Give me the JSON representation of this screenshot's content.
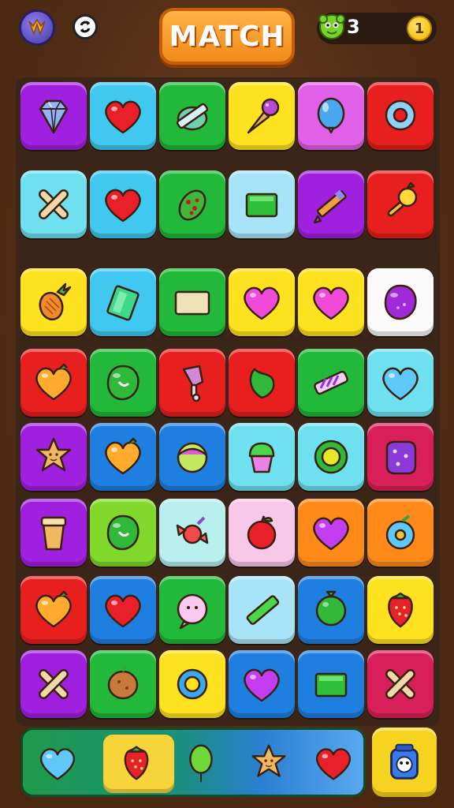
{
  "header": {
    "title": "MATCH",
    "moves": "3",
    "coins": "1"
  },
  "colors": {
    "purple": "#a020e0",
    "cyan": "#40c8f0",
    "green": "#22b83a",
    "yellow": "#ffe21f",
    "pink": "#e060e8",
    "red": "#e81f1f",
    "lightcyan": "#6fe0f0",
    "blue": "#1f7fe0",
    "lime": "#7fd82a",
    "white": "#fafafa",
    "orange": "#ff8a1a",
    "crimson": "#d81f5a",
    "paleblue": "#a8e4f8",
    "palepink": "#f7c8e8",
    "teal": "#b8f0f0"
  },
  "board": {
    "rows": [
      [
        {
          "color": "purple",
          "icon": "diamond-gem-icon"
        },
        {
          "color": "cyan",
          "icon": "heart-icon"
        },
        {
          "color": "green",
          "icon": "crossed-pencil-icon"
        },
        {
          "color": "yellow",
          "icon": "ice-cream-cone-icon"
        },
        {
          "color": "pink",
          "icon": "blue-balloon-icon"
        },
        {
          "color": "red",
          "icon": "ring-donut-icon"
        }
      ],
      [
        {
          "color": "lightcyan",
          "icon": "cross-x-icon"
        },
        {
          "color": "cyan",
          "icon": "heart-icon"
        },
        {
          "color": "green",
          "icon": "cucumber-icon"
        },
        {
          "color": "paleblue",
          "icon": "green-block-icon"
        },
        {
          "color": "purple",
          "icon": "pencil-icon"
        },
        {
          "color": "red",
          "icon": "rattle-icon"
        }
      ],
      [
        {
          "color": "yellow",
          "icon": "pineapple-icon"
        },
        {
          "color": "cyan",
          "icon": "green-card-icon"
        },
        {
          "color": "green",
          "icon": "cream-block-icon"
        },
        {
          "color": "yellow",
          "icon": "pink-heart-icon"
        },
        {
          "color": "yellow",
          "icon": "pink-heart-icon"
        },
        {
          "color": "white",
          "icon": "purple-bean-icon"
        }
      ],
      [
        {
          "color": "red",
          "icon": "orange-heart-icon"
        },
        {
          "color": "green",
          "icon": "green-drop-icon"
        },
        {
          "color": "red",
          "icon": "ice-pop-icon"
        },
        {
          "color": "red",
          "icon": "green-leaf-icon"
        },
        {
          "color": "green",
          "icon": "candy-stick-icon"
        },
        {
          "color": "lightcyan",
          "icon": "blue-heart-icon"
        }
      ],
      [
        {
          "color": "purple",
          "icon": "star-cookie-icon"
        },
        {
          "color": "blue",
          "icon": "orange-heart-icon"
        },
        {
          "color": "blue",
          "icon": "candy-ball-icon"
        },
        {
          "color": "lightcyan",
          "icon": "cupcake-icon"
        },
        {
          "color": "lightcyan",
          "icon": "sun-candy-icon"
        },
        {
          "color": "crimson",
          "icon": "purple-cube-icon"
        }
      ],
      [
        {
          "color": "purple",
          "icon": "cup-icon"
        },
        {
          "color": "lime",
          "icon": "green-drop-icon"
        },
        {
          "color": "teal",
          "icon": "wrapped-candy-icon"
        },
        {
          "color": "palepink",
          "icon": "red-apple-icon"
        },
        {
          "color": "orange",
          "icon": "purple-heart-icon"
        },
        {
          "color": "orange",
          "icon": "blue-fruit-icon"
        }
      ],
      [
        {
          "color": "red",
          "icon": "orange-heart-icon"
        },
        {
          "color": "blue",
          "icon": "red-heart-icon"
        },
        {
          "color": "green",
          "icon": "face-bubble-icon"
        },
        {
          "color": "paleblue",
          "icon": "green-stick-icon"
        },
        {
          "color": "blue",
          "icon": "green-ball-icon"
        },
        {
          "color": "yellow",
          "icon": "strawberry-icon"
        }
      ],
      [
        {
          "color": "purple",
          "icon": "cross-x-icon"
        },
        {
          "color": "green",
          "icon": "potato-icon"
        },
        {
          "color": "yellow",
          "icon": "blue-ring-icon"
        },
        {
          "color": "blue",
          "icon": "purple-heart-icon"
        },
        {
          "color": "blue",
          "icon": "green-block-icon"
        },
        {
          "color": "crimson",
          "icon": "cross-x-icon"
        }
      ]
    ]
  },
  "tray": {
    "items": [
      {
        "icon": "blue-heart-icon"
      },
      {
        "icon": "strawberry-icon"
      },
      {
        "icon": "green-balloon-icon"
      },
      {
        "icon": "star-cookie-icon"
      },
      {
        "icon": "red-heart-icon"
      }
    ],
    "selected": 1,
    "booster_icon": "robot-jar-icon"
  }
}
